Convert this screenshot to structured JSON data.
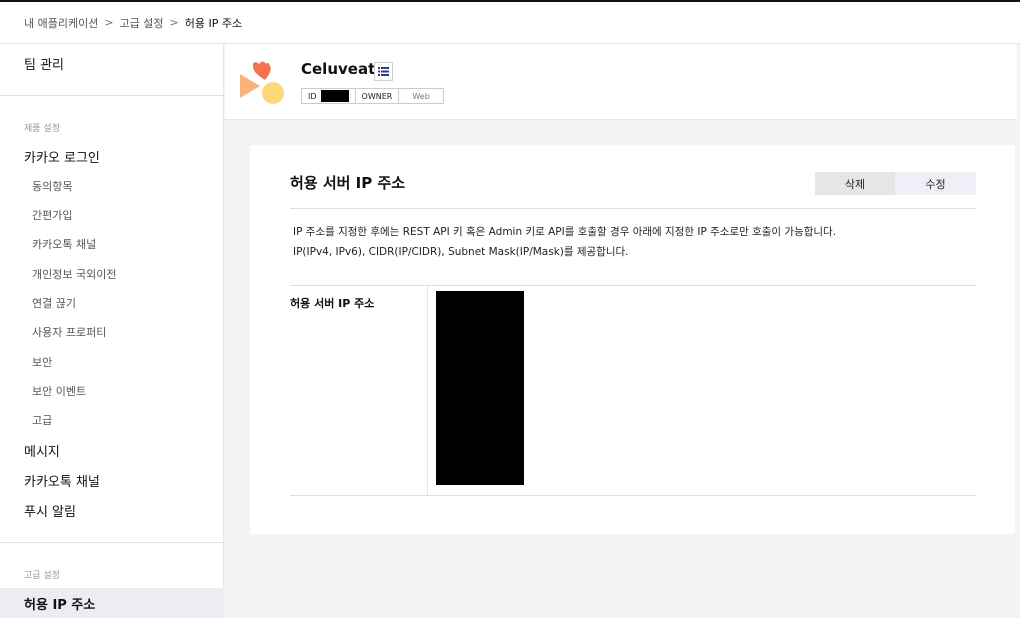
{
  "breadcrumb": {
    "items": [
      "내 애플리케이션",
      "고급 설정",
      "허용 IP 주소"
    ],
    "separator": ">"
  },
  "sidebar": {
    "team": "팀 관리",
    "section_product": "제품 설정",
    "kakao_login": "카카오 로그인",
    "sub_items": [
      "동의항목",
      "간편가입",
      "카카오톡 채널",
      "개인정보 국외이전",
      "연결 끊기",
      "사용자 프로퍼티",
      "보안",
      "보안 이벤트",
      "고급"
    ],
    "message": "메시지",
    "kakaotalk_channel": "카카오톡 채널",
    "push": "푸시 알림",
    "section_advanced": "고급 설정",
    "active_item": "허용 IP 주소"
  },
  "app": {
    "name": "Celuveat",
    "tag_id": "ID",
    "tag_owner": "OWNER",
    "tag_web": "Web"
  },
  "card": {
    "title": "허용 서버 IP 주소",
    "delete_label": "삭제",
    "edit_label": "수정",
    "desc_line1": "IP 주소를 지정한 후에는 REST API 키 혹은 Admin 키로 API를 호출할 경우 아래에 지정한 IP 주소로만 호출이 가능합니다.",
    "desc_line2": "IP(IPv4, IPv6), CIDR(IP/CIDR), Subnet Mask(IP/Mask)를 제공합니다.",
    "field_label": "허용 서버 IP 주소"
  },
  "colors": {
    "active_bg": "#ecedf2",
    "logo_orange": "#f4734f",
    "logo_peach": "#f9b27a",
    "logo_yellow": "#fcd978"
  }
}
